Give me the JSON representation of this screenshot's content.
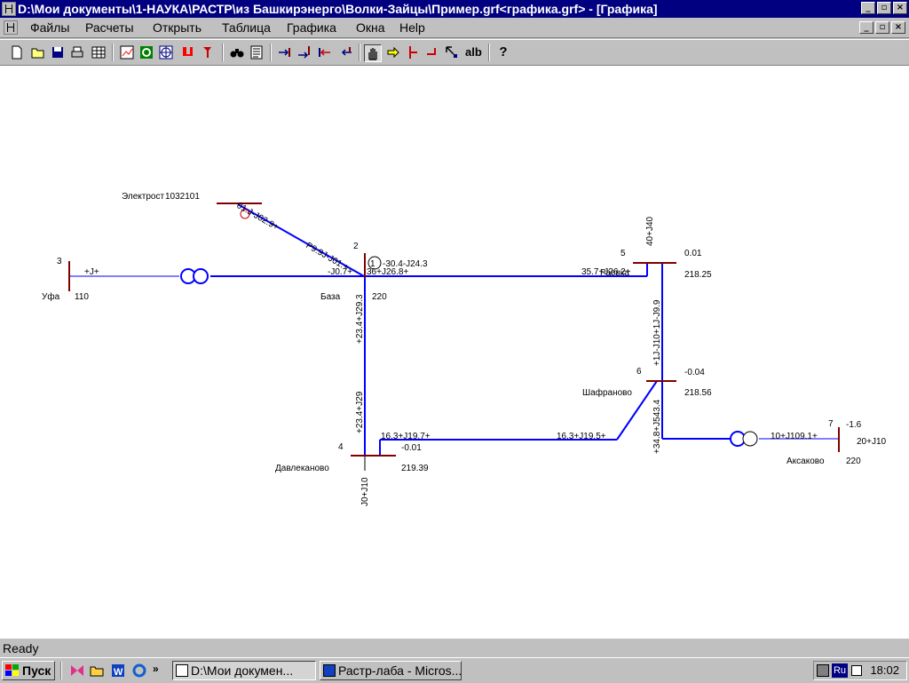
{
  "window": {
    "title": "D:\\Мои документы\\1-НАУКА\\РАСТР\\из Башкирэнерго\\Волки-Зайцы\\Пример.grf<графика.grf> - [Графика]"
  },
  "menu": [
    "Файлы",
    "Расчеты",
    "Открыть",
    "Таблица",
    "Графика",
    "Окна",
    "Help"
  ],
  "toolbar_icons": [
    "new-icon",
    "open-icon",
    "save-icon",
    "print-icon",
    "table-icon",
    "chart-icon",
    "refresh-icon",
    "grid-icon",
    "magnet-icon",
    "pin-icon",
    "binoculars-icon",
    "list-icon",
    "flow-right-icon",
    "flow-right2-icon",
    "flow-left-icon",
    "flow-left2-icon",
    "hand-icon",
    "arrow-icon",
    "node-icon",
    "branch-icon",
    "select-icon",
    "alb-icon",
    "help-icon"
  ],
  "toolbar_alb": "alb",
  "toolbar_help": "?",
  "status": "Ready",
  "taskbar": {
    "start": "Пуск",
    "tasks": [
      "D:\\Мои докумен...",
      "Растр-лаба - Micros..."
    ],
    "lang": "Ru",
    "clock": "18:02"
  },
  "colors": {
    "line": "#0000ff",
    "bus": "#800000",
    "accent": "#000080"
  },
  "diagram": {
    "nodes": [
      {
        "id": "node-ufa",
        "num": "3",
        "name": "Уфа",
        "v": "110",
        "extra": ""
      },
      {
        "id": "node-baza",
        "num": "2",
        "name": "База",
        "v": "220",
        "extra": ""
      },
      {
        "id": "node-elec",
        "num": "",
        "name": "Электрост",
        "v": "",
        "extra": "1032101"
      },
      {
        "id": "node-5",
        "num": "5",
        "name": "Раевка",
        "v": "218.25",
        "extra": "0.01"
      },
      {
        "id": "node-shaf",
        "num": "6",
        "name": "Шафраново",
        "v": "218.56",
        "extra": "-0.04"
      },
      {
        "id": "node-davl",
        "num": "4",
        "name": "Давлеканово",
        "v": "219.39",
        "extra": "-0.01"
      },
      {
        "id": "node-aks",
        "num": "7",
        "name": "Аксаково",
        "v": "220",
        "extra": "-1.6"
      }
    ],
    "flows": {
      "ufa_out": "+J+",
      "baza_left": "-J0.7+",
      "baza_right": "36+J26.8+",
      "gen": "-30.4-J24.3",
      "gen_num": "1",
      "elec_top": "01.J-J02.9+",
      "elec_mid": "P9.9J-J01.+",
      "n5_left": "35.7+J26.2+",
      "n5_top": "40+J40",
      "n5_down": "+1J-J10+1J-J9.9",
      "baza_down_top": "+23.4+J29.3",
      "baza_down_bot": "+23.4+J29",
      "davl_right": "16.3+J19.7+",
      "shaf_left": "16.3+J19.5+",
      "shaf_down": "+34.8+J543.4",
      "aks_left": "10+J109.1+",
      "aks_right": "20+J10",
      "davl_down": "J0+J10"
    }
  }
}
